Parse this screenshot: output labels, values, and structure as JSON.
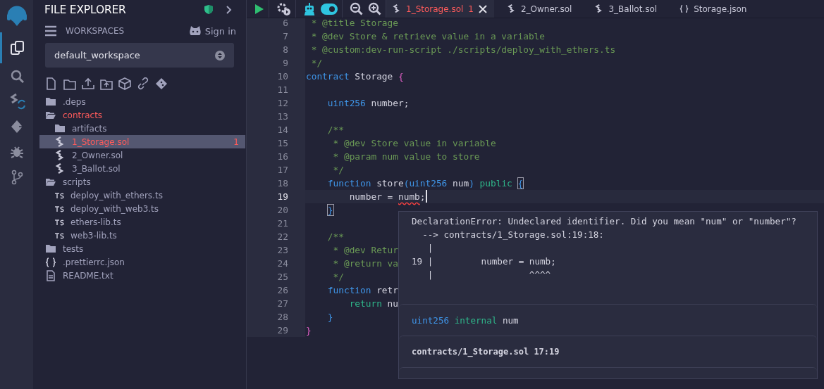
{
  "activity_bar": [
    {
      "kind": "files",
      "selected": true
    },
    {
      "kind": "search",
      "selected": false
    },
    {
      "kind": "compiler",
      "selected": false
    },
    {
      "kind": "deploy",
      "selected": false
    },
    {
      "kind": "debug",
      "selected": false
    },
    {
      "kind": "git",
      "selected": false
    }
  ],
  "explorer": {
    "title": "FILE EXPLORER",
    "workspaces_label": "WORKSPACES",
    "sign_in": "Sign in",
    "workspace": "default_workspace",
    "tree": [
      {
        "name": ".deps",
        "kind": "folder",
        "expanded": false,
        "selected": false,
        "error": false
      },
      {
        "name": "contracts",
        "kind": "folder",
        "expanded": true,
        "selected": false,
        "error": true,
        "children": [
          {
            "name": "artifacts",
            "kind": "folder",
            "expanded": false,
            "selected": false,
            "error": false
          },
          {
            "name": "1_Storage.sol",
            "kind": "sol",
            "selected": true,
            "error": true,
            "badge": "1"
          },
          {
            "name": "2_Owner.sol",
            "kind": "sol",
            "selected": false,
            "error": false
          },
          {
            "name": "3_Ballot.sol",
            "kind": "sol",
            "selected": false,
            "error": false
          }
        ]
      },
      {
        "name": "scripts",
        "kind": "folder",
        "expanded": true,
        "selected": false,
        "error": false,
        "children": [
          {
            "name": "deploy_with_ethers.ts",
            "kind": "ts",
            "selected": false,
            "error": false
          },
          {
            "name": "deploy_with_web3.ts",
            "kind": "ts",
            "selected": false,
            "error": false
          },
          {
            "name": "ethers-lib.ts",
            "kind": "ts",
            "selected": false,
            "error": false
          },
          {
            "name": "web3-lib.ts",
            "kind": "ts",
            "selected": false,
            "error": false
          }
        ]
      },
      {
        "name": "tests",
        "kind": "folder",
        "expanded": false,
        "selected": false,
        "error": false
      },
      {
        "name": ".prettierrc.json",
        "kind": "json",
        "selected": false,
        "error": false
      },
      {
        "name": "README.txt",
        "kind": "txt",
        "selected": false,
        "error": false
      }
    ]
  },
  "toolbar": {
    "copilot_toggle": {
      "on": true
    }
  },
  "tabs": [
    {
      "label": "1_Storage.sol",
      "kind": "sol",
      "selected": true,
      "error": true,
      "badge": "1"
    },
    {
      "label": "2_Owner.sol",
      "kind": "sol",
      "selected": false,
      "error": false
    },
    {
      "label": "3_Ballot.sol",
      "kind": "sol",
      "selected": false,
      "error": false
    },
    {
      "label": "Storage.json",
      "kind": "json",
      "selected": false,
      "error": false
    }
  ],
  "editor": {
    "lines": [
      {
        "number": "6",
        "current": false,
        "tokens": [
          {
            "kind": "comment",
            "text": " * @title Storage"
          }
        ]
      },
      {
        "number": "7",
        "current": false,
        "tokens": [
          {
            "kind": "comment",
            "text": " * @dev Store & retrieve value in a variable"
          }
        ]
      },
      {
        "number": "8",
        "current": false,
        "tokens": [
          {
            "kind": "comment",
            "text": " * @custom:dev-run-script ./scripts/deploy_with_ethers.ts"
          }
        ]
      },
      {
        "number": "9",
        "current": false,
        "tokens": [
          {
            "kind": "comment",
            "text": " */"
          }
        ]
      },
      {
        "number": "10",
        "current": false,
        "tokens": [
          {
            "kind": "keyword",
            "text": "contract"
          },
          {
            "kind": "plain",
            "text": " Storage "
          },
          {
            "kind": "brace",
            "text": "{"
          }
        ]
      },
      {
        "number": "11",
        "current": false
      },
      {
        "number": "12",
        "current": false,
        "tokens": [
          {
            "kind": "keyword",
            "text": "    uint256"
          },
          {
            "kind": "plain",
            "text": " number;"
          }
        ]
      },
      {
        "number": "13",
        "current": false
      },
      {
        "number": "14",
        "current": false,
        "tokens": [
          {
            "kind": "comment",
            "text": "    /**"
          }
        ]
      },
      {
        "number": "15",
        "current": false,
        "tokens": [
          {
            "kind": "comment",
            "text": "     * @dev Store value in variable"
          }
        ]
      },
      {
        "number": "16",
        "current": false,
        "tokens": [
          {
            "kind": "comment",
            "text": "     * @param num value to store"
          }
        ]
      },
      {
        "number": "17",
        "current": false,
        "tokens": [
          {
            "kind": "comment",
            "text": "     */"
          }
        ]
      },
      {
        "number": "18",
        "current": false,
        "tokens": [
          {
            "kind": "keyword",
            "text": "    function"
          },
          {
            "kind": "plain",
            "text": " store"
          },
          {
            "kind": "keyword",
            "text": "(uint256"
          },
          {
            "kind": "plain",
            "text": " num"
          },
          {
            "kind": "keyword",
            "text": ")"
          },
          {
            "kind": "modifier",
            "text": " public "
          },
          {
            "kind": "match",
            "text": "{"
          }
        ]
      },
      {
        "number": "19",
        "current": true,
        "tokens": [
          {
            "kind": "plain",
            "text": "        number = "
          },
          {
            "kind": "error",
            "text": "numb"
          },
          {
            "kind": "plain",
            "text": ";"
          }
        ]
      },
      {
        "number": "20",
        "current": false,
        "tokens": [
          {
            "kind": "match",
            "text": "    }"
          }
        ]
      },
      {
        "number": "21",
        "current": false
      },
      {
        "number": "22",
        "current": false,
        "tokens": [
          {
            "kind": "comment",
            "text": "    /**"
          }
        ]
      },
      {
        "number": "23",
        "current": false,
        "tokens": [
          {
            "kind": "comment",
            "text": "     * @dev Retur"
          }
        ]
      },
      {
        "number": "24",
        "current": false,
        "tokens": [
          {
            "kind": "comment",
            "text": "     * @return va"
          }
        ]
      },
      {
        "number": "25",
        "current": false,
        "tokens": [
          {
            "kind": "comment",
            "text": "     */"
          }
        ]
      },
      {
        "number": "26",
        "current": false,
        "tokens": [
          {
            "kind": "keyword",
            "text": "    function"
          },
          {
            "kind": "plain",
            "text": " retr"
          }
        ]
      },
      {
        "number": "27",
        "current": false,
        "tokens": [
          {
            "kind": "modifier",
            "text": "        return"
          },
          {
            "kind": "plain",
            "text": " nu"
          }
        ]
      },
      {
        "number": "28",
        "current": false,
        "tokens": [
          {
            "kind": "keyword",
            "text": "    }"
          }
        ]
      },
      {
        "number": "29",
        "current": false,
        "tokens": [
          {
            "kind": "brace",
            "text": "}"
          }
        ]
      }
    ]
  },
  "hover": {
    "message_lines": [
      "DeclarationError: Undeclared identifier. Did you mean \"num\" or \"number\"?",
      "  --> contracts/1_Storage.sol:19:18:",
      "   |",
      "19 |         number = numb;",
      "   |                  ^^^^"
    ],
    "signature": [
      {
        "kind": "type",
        "text": "uint256"
      },
      {
        "kind": "modifier",
        "text": "internal"
      },
      {
        "kind": "plain",
        "text": "num"
      }
    ],
    "location": "contracts/1_Storage.sol 17:19"
  }
}
